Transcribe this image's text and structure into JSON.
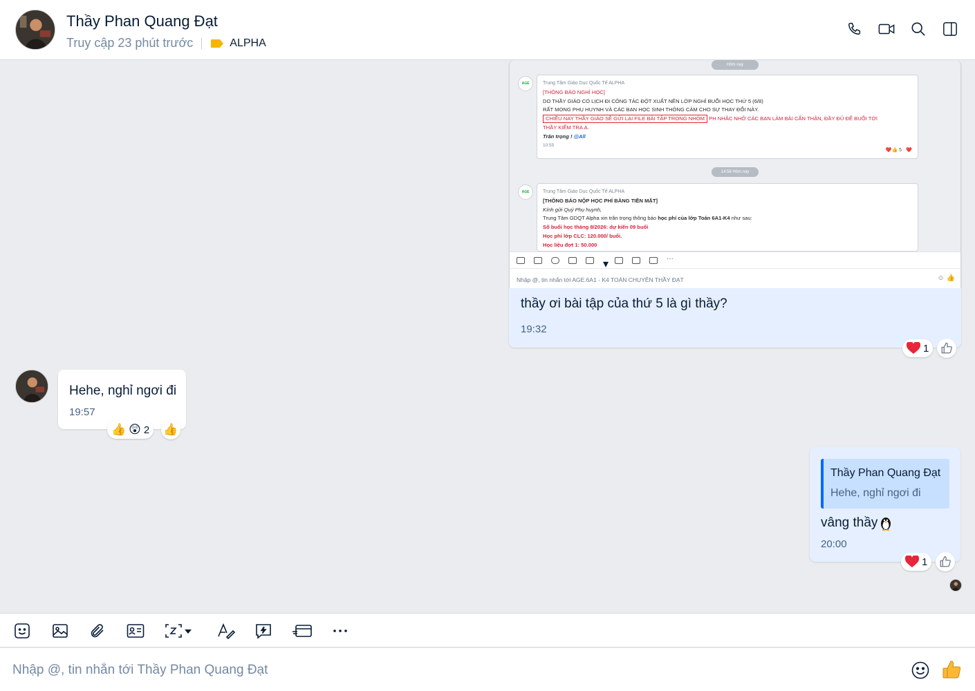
{
  "header": {
    "name": "Thầy Phan Quang Đạt",
    "last_seen": "Truy cập 23 phút trước",
    "tag": "ALPHA",
    "tag_color": "#f7b500"
  },
  "messages": {
    "m1": {
      "shot": {
        "pill_top": "Hôm nay",
        "pill_mid": "14:58 Hôm nay",
        "card1": {
          "from": "Trung Tâm Giáo Dục Quốc Tế ALPHA",
          "title": "[THÔNG BÁO NGHỈ HỌC]",
          "line1": "DO THẦY GIÁO CÓ LỊCH ĐI CÔNG TÁC ĐỘT XUẤT NÊN LỚP NGHỈ BUỔI HỌC THỨ 5 (6/8)",
          "line2": "RẤT MONG PHỤ HUYNH VÀ CÁC BẠN HỌC SINH THÔNG CẢM CHO SỰ THAY ĐỔI NÀY.",
          "highlight": "CHIỀU NAY THẦY GIÁO SẼ GỬI LẠI FILE BÀI TẬP TRONG NHÓM",
          "line3": "PH NHẮC NHỞ CÁC BẠN LÀM BÀI CẨN THẬN, ĐẦY ĐỦ ĐỂ BUỔI TỚI",
          "line4": "THẦY KIỂM TRA Ạ.",
          "sign": "Trân trọng !",
          "mention": "@All",
          "time": "10:55",
          "reacts": "❤️👍 5 · ❤️"
        },
        "card2": {
          "from": "Trung Tâm Giáo Dục Quốc Tế ALPHA",
          "title": "[THÔNG BÁO NỘP HỌC PHÍ BẰNG TIỀN MẶT]",
          "greet": "Kính gửi Quý Phụ huynh,",
          "line1a": "Trung Tâm GDQT Alpha xin trân trọng thông báo",
          "line1b": "học phí của lớp Toán 6A1-K4",
          "line1c": "như sau:",
          "line2": "Số buổi học tháng 8/2026: dự kiến 09 buổi",
          "line3": "Học phí lớp CLC: 120.000/ buổi.",
          "line4": "Học liệu đợt 1: 50.000"
        },
        "input_hint": "Nhập @, tin nhắn tới AGE.6A1 - K4 TOÁN CHUYÊN THẦY ĐẠT"
      },
      "text": "thầy ơi bài tập của thứ 5 là gì thầy?",
      "time": "19:32",
      "reaction_count": "1"
    },
    "m2": {
      "text": "Hehe, nghỉ ngơi đi",
      "time": "19:57",
      "reaction_count": "2"
    },
    "m3": {
      "quote_name": "Thầy Phan Quang Đạt",
      "quote_text": "Hehe, nghỉ ngơi đi",
      "text": "vâng thầy",
      "time": "20:00",
      "reaction_count": "1"
    }
  },
  "composer": {
    "placeholder": "Nhập @, tin nhắn tới Thầy Phan Quang Đạt"
  },
  "colors": {
    "accent": "#0068ff",
    "my_bubble": "#e5efff",
    "background": "#ebecf0"
  }
}
